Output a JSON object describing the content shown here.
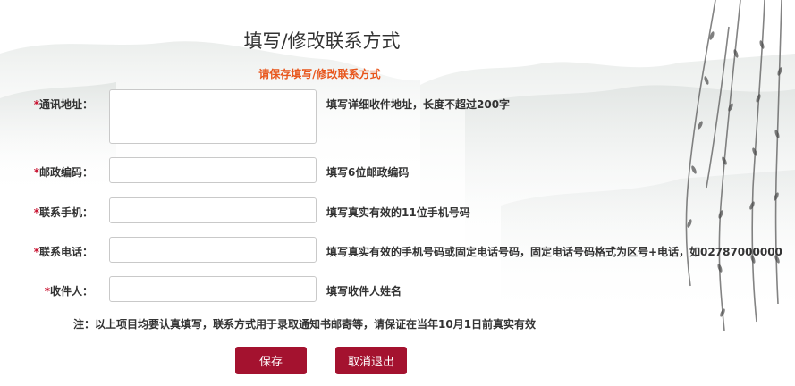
{
  "page": {
    "title": "填写/修改联系方式",
    "subtitle": "请保存填写/修改联系方式"
  },
  "form": {
    "fields": [
      {
        "required_mark": "*",
        "label": "通讯地址：",
        "value": "",
        "hint": "填写详细收件地址，长度不超过200字"
      },
      {
        "required_mark": "*",
        "label": "邮政编码：",
        "value": "",
        "hint": "填写6位邮政编码"
      },
      {
        "required_mark": "*",
        "label": "联系手机：",
        "value": "",
        "hint": "填写真实有效的11位手机号码"
      },
      {
        "required_mark": "*",
        "label": "联系电话：",
        "value": "",
        "hint": "填写真实有效的手机号码或固定电话号码，固定电话号码格式为区号+电话，如02787000000"
      },
      {
        "required_mark": "*",
        "label": "收件人：",
        "value": "",
        "hint": "填写收件人姓名"
      }
    ],
    "note": "注：以上项目均要认真填写，联系方式用于录取通知书邮寄等，请保证在当年10月1日前真实有效"
  },
  "buttons": {
    "save": "保存",
    "cancel": "取消退出"
  },
  "colors": {
    "accent": "#a4122f",
    "subtitle": "#e8561c",
    "required": "#c8102e"
  }
}
